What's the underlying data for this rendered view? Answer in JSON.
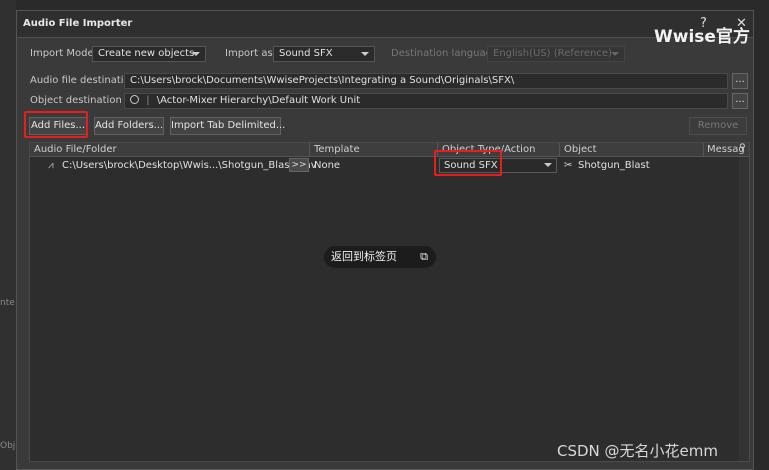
{
  "dialog": {
    "title": "Audio File Importer",
    "help_glyph": "?",
    "close_glyph": "✕"
  },
  "import": {
    "mode_label": "Import Mode:",
    "mode_value": "Create new objects",
    "as_label": "Import as:",
    "as_value": "Sound SFX",
    "lang_label": "Destination language:",
    "lang_value": "English(US) (Reference)"
  },
  "destinations": {
    "audio_label": "Audio file destination",
    "audio_path": "C:\\Users\\brock\\Documents\\WwiseProjects\\Integrating a Sound\\Originals\\SFX\\",
    "object_label": "Object destination",
    "object_path": "\\Actor-Mixer Hierarchy\\Default Work Unit",
    "browse_label": "..."
  },
  "buttons": {
    "add_files": "Add Files...",
    "add_folders": "Add Folders...",
    "import_tab": "Import Tab Delimited...",
    "remove": "Remove"
  },
  "grid": {
    "columns": [
      "Audio File/Folder",
      "Template",
      "Object Type/Action",
      "Object",
      "Messag"
    ],
    "rows": [
      {
        "file": "C:\\Users\\brock\\Desktop\\Wwis...\\Shotgun_Blast.wav",
        "arrow": ">>",
        "template": "None",
        "type": "Sound SFX",
        "object": "Shotgun_Blast"
      }
    ]
  },
  "overlay": {
    "tooltip": "返回到标签页",
    "brand": "Wwise官方",
    "watermark": "CSDN @无名小花emm",
    "edge_left_1": "nte",
    "edge_left_2": "Obj"
  },
  "colors": {
    "highlight": "#e81e1e",
    "dialog_bg": "#3a3a3a"
  }
}
